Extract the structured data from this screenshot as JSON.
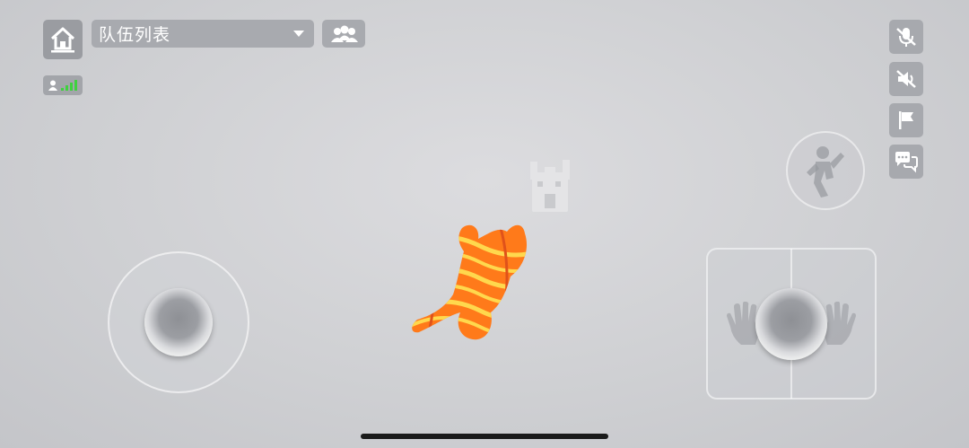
{
  "header": {
    "team_list_label": "队伍列表"
  },
  "icons": {
    "home": "home-icon",
    "dropdown": "triangle-down-icon",
    "team": "team-members-icon",
    "network": "player-signal-icon",
    "mic_off": "mic-muted-icon",
    "sound_off": "sound-muted-icon",
    "flag": "flag-icon",
    "chat": "chat-bubbles-icon",
    "action": "jump-person-icon",
    "grab": "grab-hands-icon"
  },
  "colors": {
    "button_bg": "#a8aaaf",
    "signal_green": "#3fd13f",
    "character_orange": "#ff7a1a",
    "character_stripe": "#ffd84d"
  }
}
